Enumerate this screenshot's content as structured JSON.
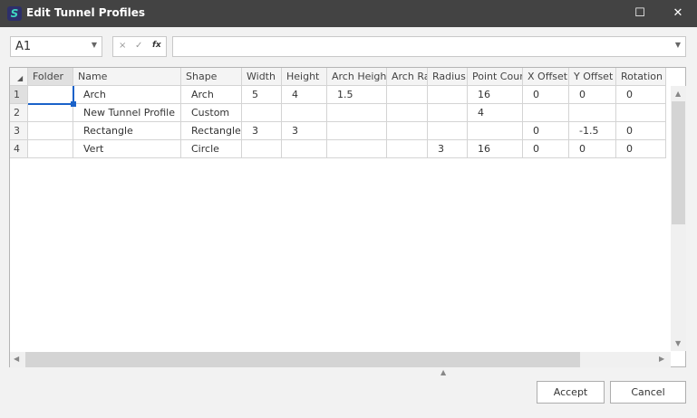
{
  "window": {
    "title": "Edit Tunnel Profiles",
    "icon": "app-logo-icon",
    "minimize": "☐",
    "close": "✕"
  },
  "formula_bar": {
    "name_box": "A1",
    "cancel": "×",
    "confirm": "✓",
    "fx": "fx",
    "value": ""
  },
  "grid": {
    "columns": [
      "Folder",
      "Name",
      "Shape",
      "Width",
      "Height",
      "Arch Height",
      "Arch Ratio",
      "Radius",
      "Point Count",
      "X Offset",
      "Y Offset",
      "Rotation"
    ],
    "rows": [
      {
        "num": "1",
        "cells": [
          "",
          "Arch",
          "Arch",
          "5",
          "4",
          "1.5",
          "",
          "",
          "16",
          "0",
          "0",
          "0"
        ]
      },
      {
        "num": "2",
        "cells": [
          "",
          "New Tunnel Profile",
          "Custom",
          "",
          "",
          "",
          "",
          "",
          "4",
          "",
          "",
          ""
        ]
      },
      {
        "num": "3",
        "cells": [
          "",
          "Rectangle",
          "Rectangle",
          "3",
          "3",
          "",
          "",
          "",
          "",
          "0",
          "-1.5",
          "0"
        ]
      },
      {
        "num": "4",
        "cells": [
          "",
          "Vert",
          "Circle",
          "",
          "",
          "",
          "",
          "3",
          "16",
          "0",
          "0",
          "0"
        ]
      }
    ],
    "selected_cell": "A1"
  },
  "buttons": {
    "accept": "Accept",
    "cancel": "Cancel"
  }
}
